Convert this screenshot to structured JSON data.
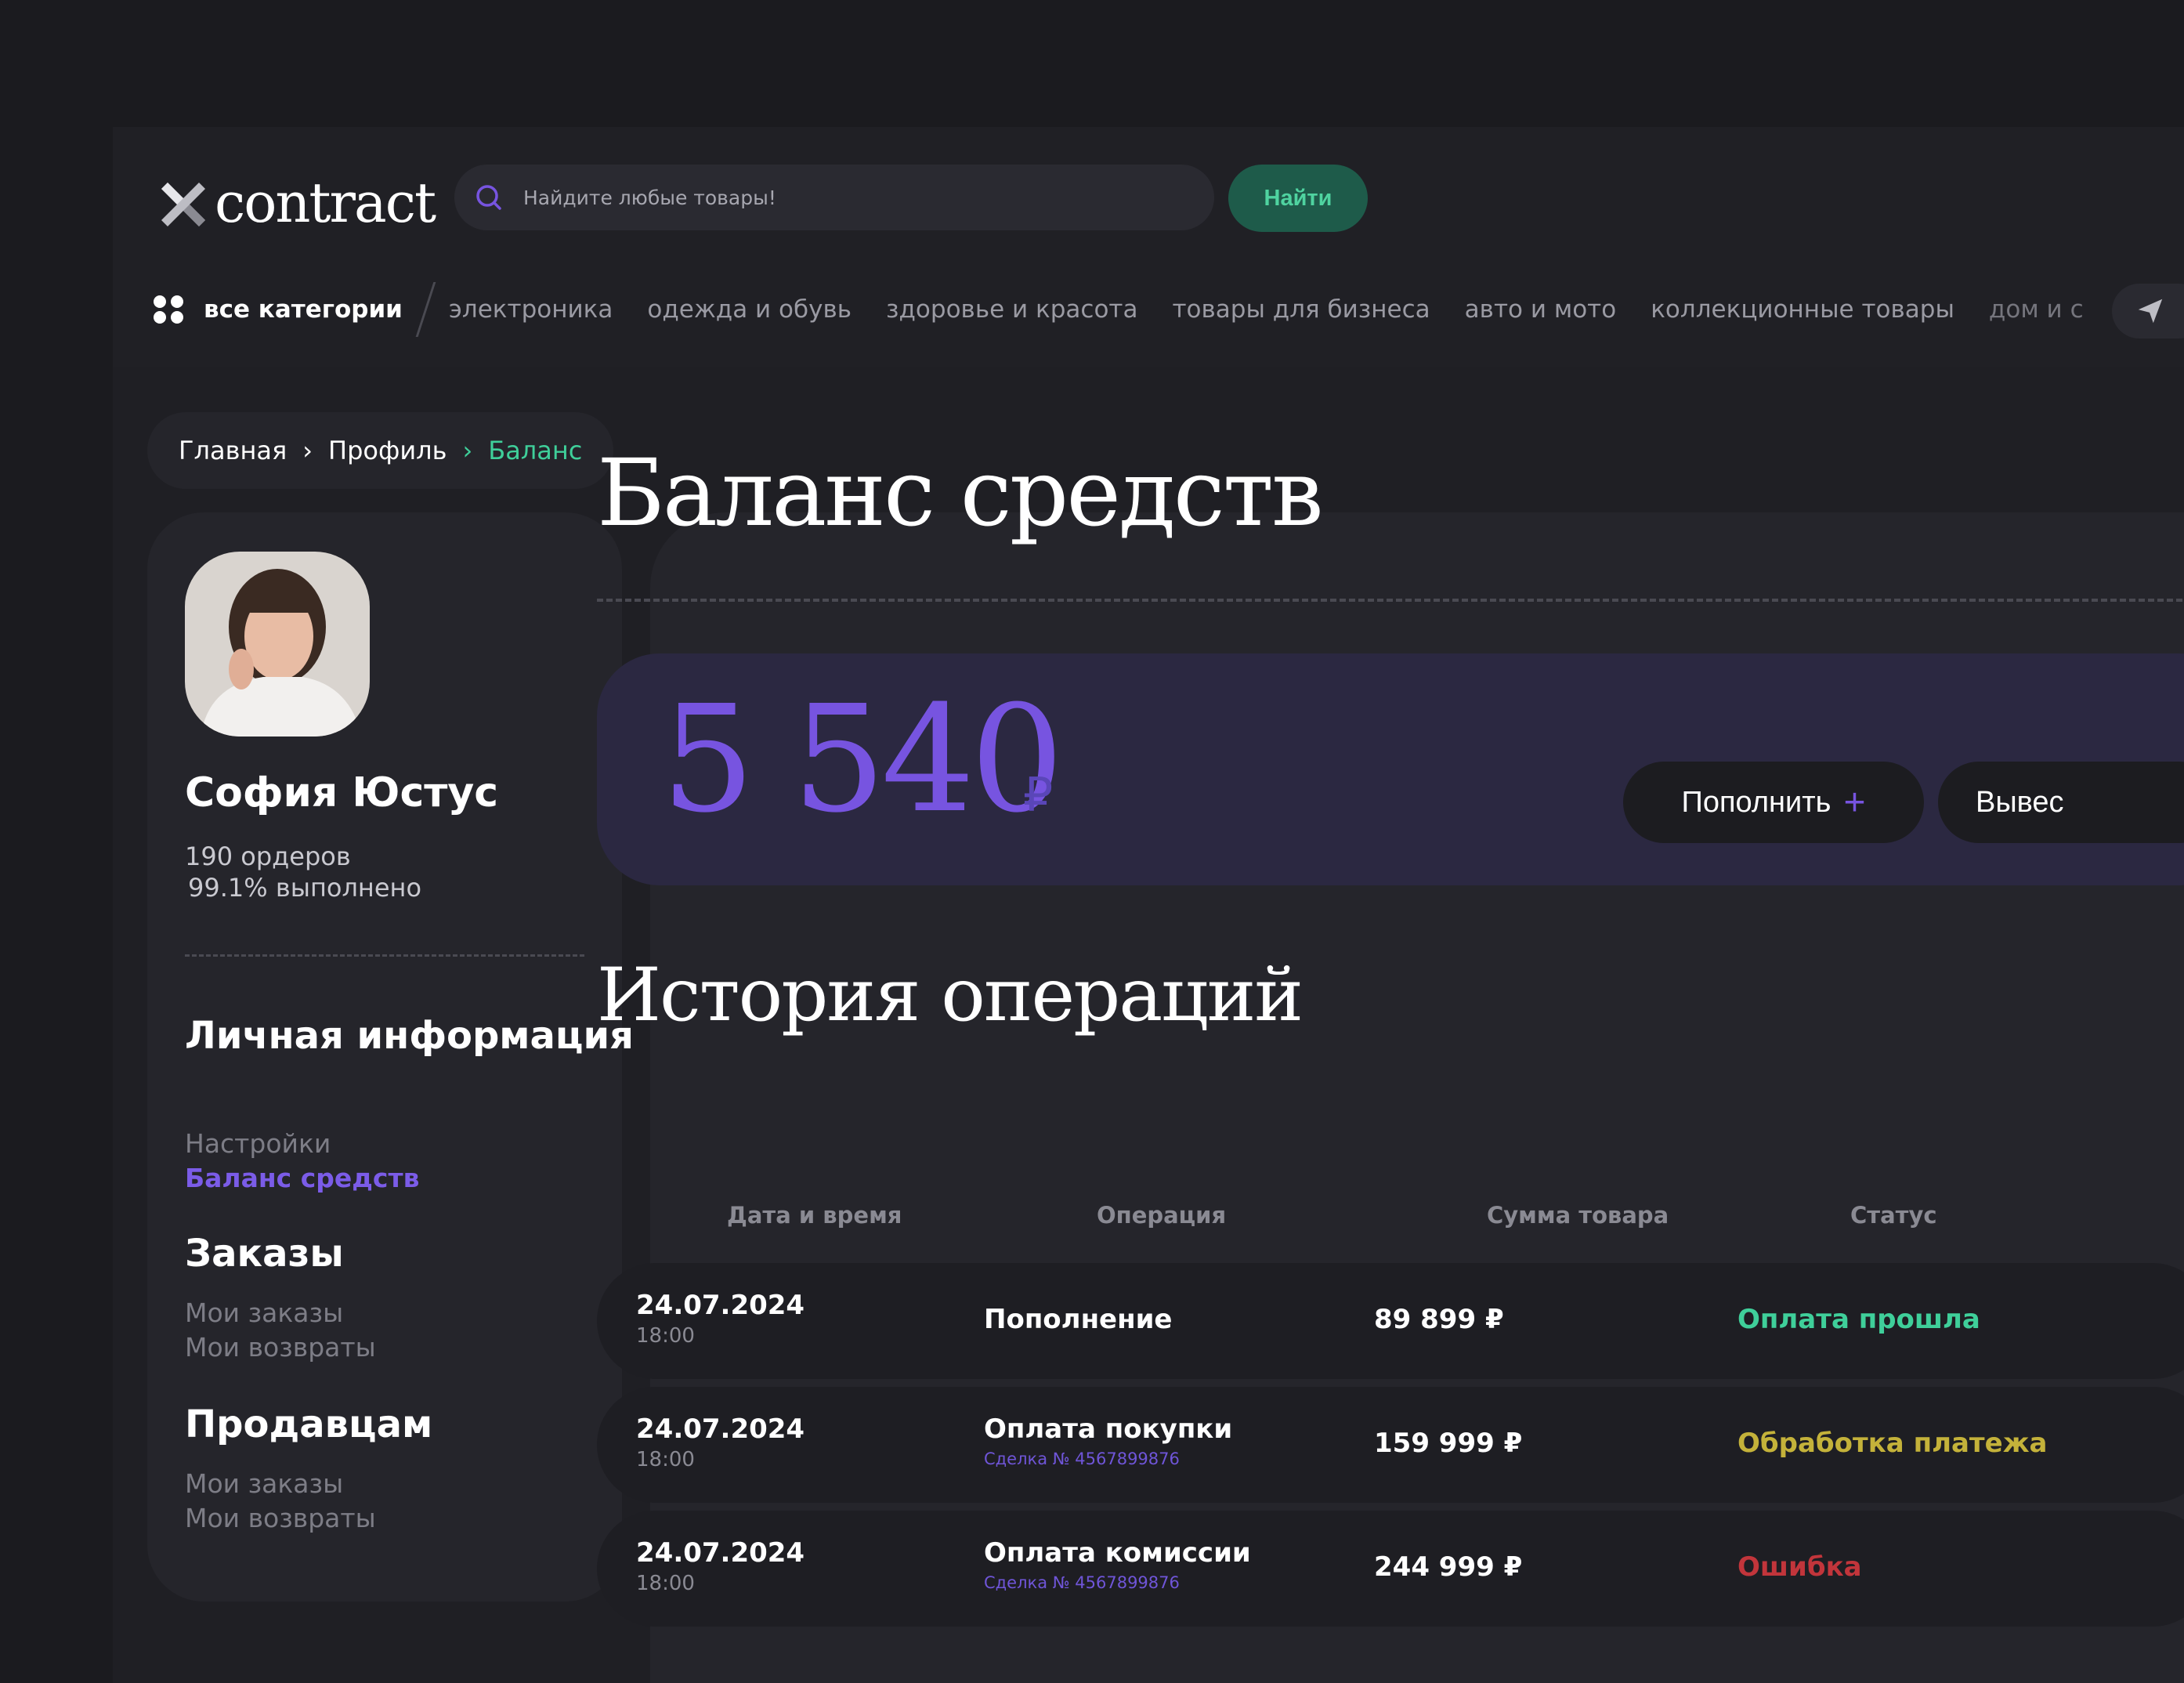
{
  "brand": {
    "name": "contract"
  },
  "search": {
    "placeholder": "Найдите любые товары!",
    "button_label": "Найти"
  },
  "nav": {
    "all_categories": "все категории",
    "categories": [
      "электроника",
      "одежда и обувь",
      "здоровье и красота",
      "товары для бизнеса",
      "авто и мото",
      "коллекционные товары",
      "дом и с"
    ]
  },
  "breadcrumb": {
    "items": [
      "Главная",
      "Профиль"
    ],
    "current": "Баланс"
  },
  "profile": {
    "name": "София Юстус",
    "orders": "190 ордеров",
    "completed": "99.1% выполнено"
  },
  "sidebar": {
    "sections": [
      {
        "title": "Личная информация",
        "items": [
          {
            "label": "Настройки"
          },
          {
            "label": "Баланс средств",
            "active": true
          }
        ]
      },
      {
        "title": "Заказы",
        "items": [
          {
            "label": "Мои заказы"
          },
          {
            "label": "Мои возвраты"
          }
        ]
      },
      {
        "title": "Продавцам",
        "items": [
          {
            "label": "Мои заказы"
          },
          {
            "label": "Мои возвраты"
          }
        ]
      }
    ]
  },
  "balance": {
    "title": "Баланс средств",
    "amount": "5 540",
    "currency": "₽",
    "topup_label": "Пополнить",
    "withdraw_label": "Вывес"
  },
  "history": {
    "title": "История операций",
    "columns": [
      "Дата и время",
      "Операция",
      "Сумма товара",
      "Статус"
    ],
    "rows": [
      {
        "date": "24.07.2024",
        "time": "18:00",
        "operation": "Пополнение",
        "deal": "",
        "amount": "89 899 ₽",
        "status": "Оплата прошла",
        "status_color": "#3fcf9a"
      },
      {
        "date": "24.07.2024",
        "time": "18:00",
        "operation": "Оплата покупки",
        "deal": "Сделка № 4567899876",
        "amount": "159 999 ₽",
        "status": "Обработка платежа",
        "status_color": "#c4b23a"
      },
      {
        "date": "24.07.2024",
        "time": "18:00",
        "operation": "Оплата комиссии",
        "deal": "Сделка № 4567899876",
        "amount": "244 999 ₽",
        "status": "Ошибка",
        "status_color": "#c2353b"
      }
    ]
  },
  "colors": {
    "accent": "#7754e0",
    "success": "#3fcf9a",
    "warning": "#c4b23a",
    "error": "#c2353b",
    "background": "#1f1f24"
  },
  "icons": {
    "search": "search-icon",
    "send": "send-icon",
    "grid": "grid-dots-icon",
    "chevron": "chevron-right-icon",
    "plus": "plus-icon"
  }
}
